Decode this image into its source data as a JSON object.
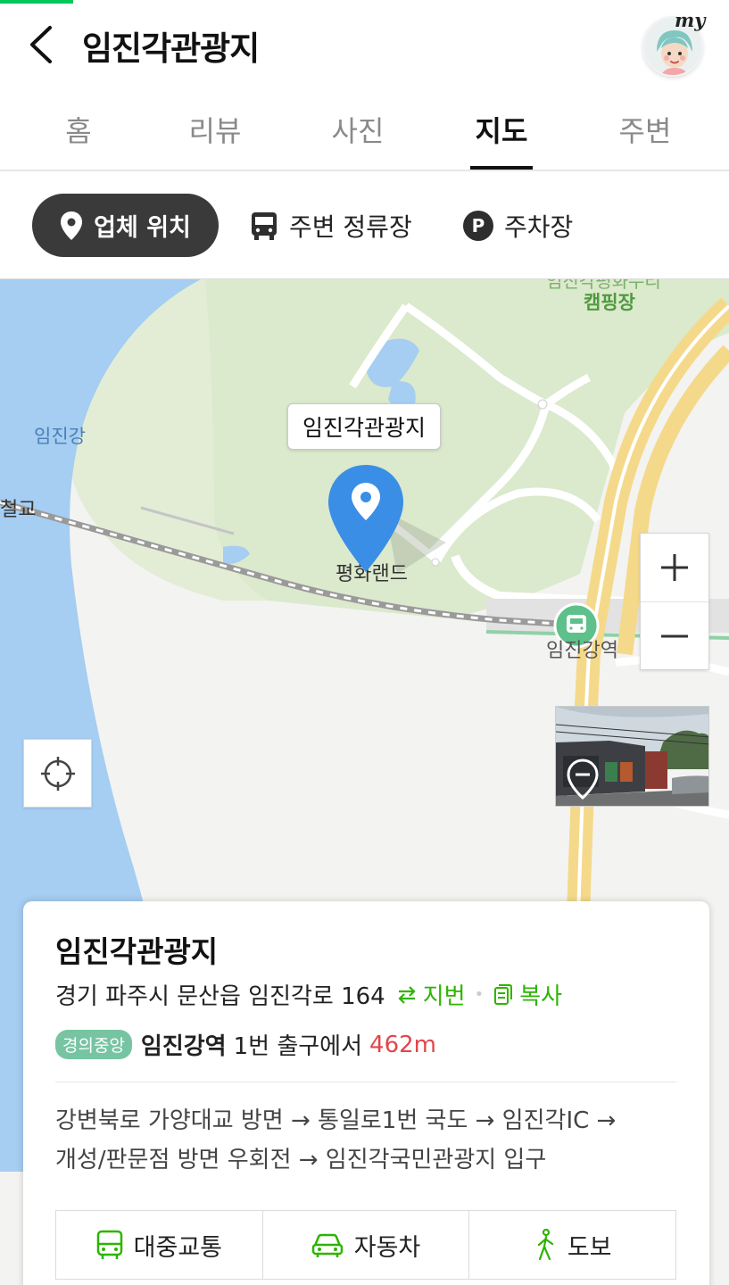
{
  "header": {
    "title": "임진각관광지",
    "avatar_label": "my"
  },
  "tabs": [
    {
      "label": "홈",
      "active": false
    },
    {
      "label": "리뷰",
      "active": false
    },
    {
      "label": "사진",
      "active": false
    },
    {
      "label": "지도",
      "active": true
    },
    {
      "label": "주변",
      "active": false
    }
  ],
  "filters": {
    "business_location": "업체 위치",
    "nearby_stops": "주변 정류장",
    "parking": "주차장",
    "parking_icon": "P"
  },
  "map": {
    "labels": {
      "river": "임진강",
      "bridge": "철교",
      "park": "평화랜드",
      "station": "임진강역",
      "camping": "캠핑장",
      "camping_partial": "임진각평화누리"
    },
    "callout": "임진각관광지",
    "colors": {
      "water": "#a6cdf2",
      "park": "#dbe9cc",
      "road_yellow": "#f5d98a",
      "pin": "#3a8ee6",
      "station_icon": "#5ec08a"
    }
  },
  "info": {
    "name": "임진각관광지",
    "address": "경기 파주시 문산읍 임진각로 164",
    "lot_number_label": "지번",
    "copy_label": "복사",
    "subway_line": "경의중앙",
    "station": "임진강역",
    "exit_text": "1번 출구에서",
    "distance": "462m",
    "directions_line1": "강변북로 가양대교 방면 → 통일로1번 국도 → 임진각IC →",
    "directions_line2": "개성/판문점 방면 우회전 → 임진각국민관광지 입구"
  },
  "routes": [
    {
      "label": "대중교통",
      "icon": "bus-icon"
    },
    {
      "label": "자동차",
      "icon": "car-icon"
    },
    {
      "label": "도보",
      "icon": "walk-icon"
    }
  ]
}
